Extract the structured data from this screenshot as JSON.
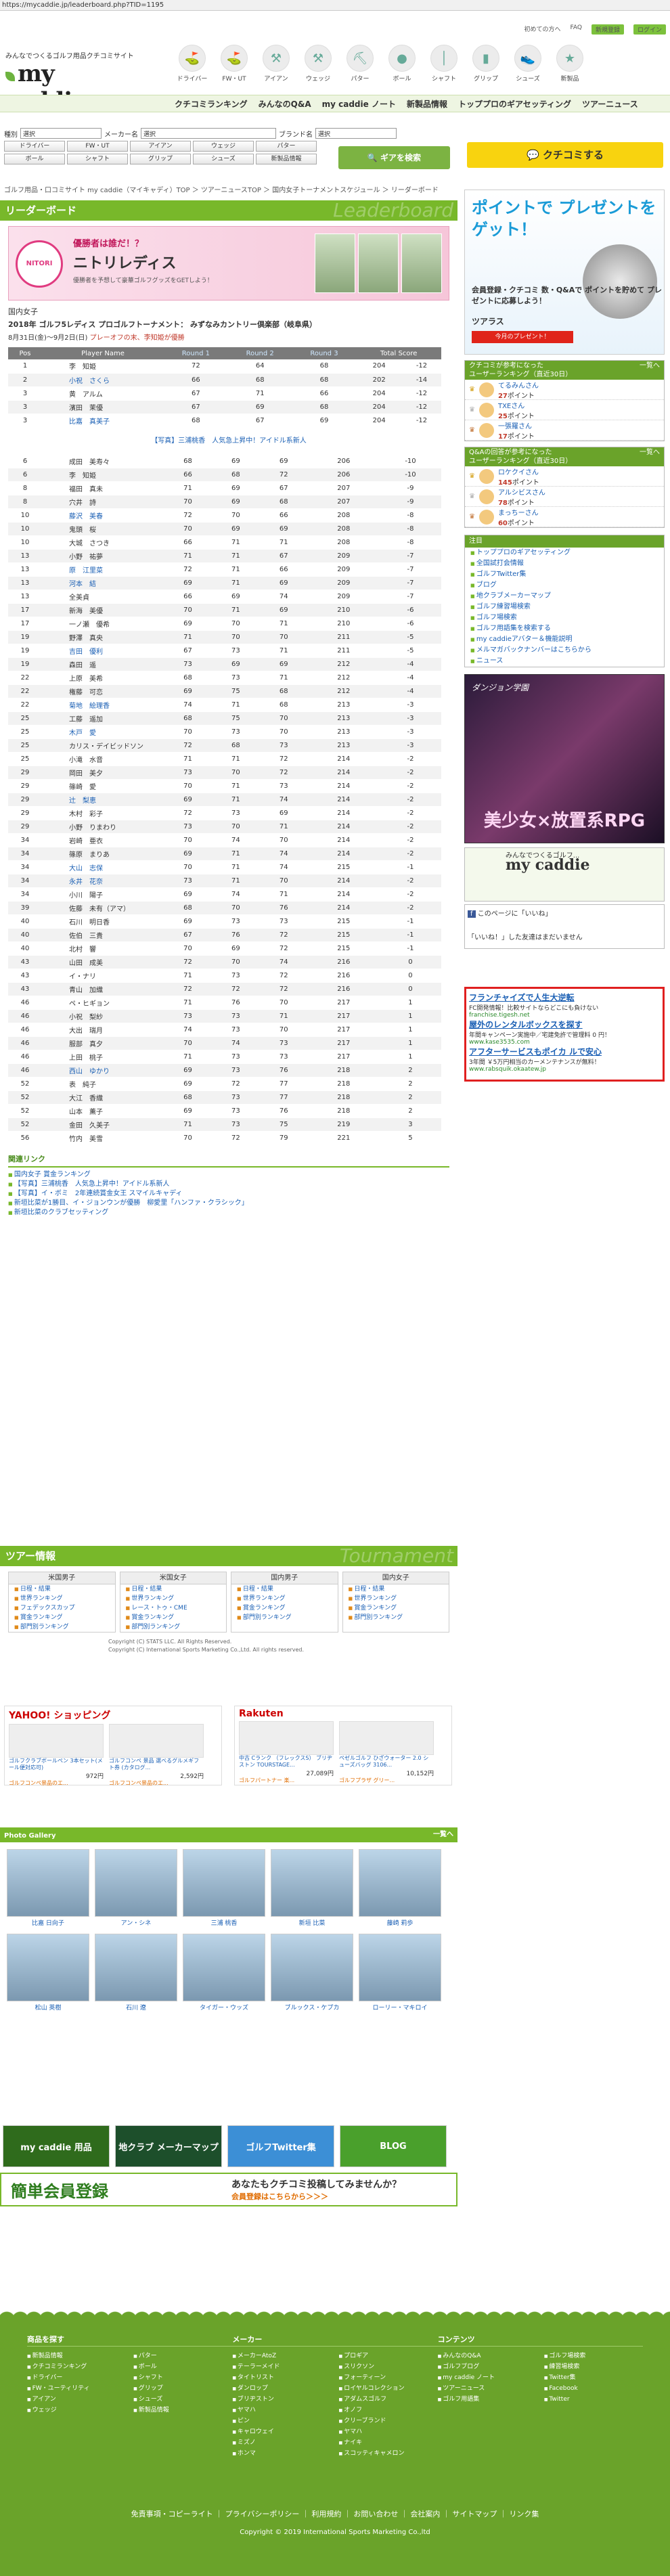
{
  "url": "https://mycaddie.jp/leaderboard.php?TID=1195",
  "header": {
    "tagline": "みんなでつくるゴルフ用品クチコミサイト",
    "logo": "my caddie",
    "toplinks": [
      "初めての方へ",
      "FAQ",
      "新規登録",
      "ログイン"
    ],
    "categories": [
      "ドライバー",
      "FW・UT",
      "アイアン",
      "ウェッジ",
      "パター",
      "ボール",
      "シャフト",
      "グリップ",
      "シューズ",
      "新製品"
    ],
    "nav": [
      "クチコミランキング",
      "みんなのQ&A",
      "my caddie ノート",
      "新製品情報",
      "トッププロのギアセッティング",
      "ツアーニュース"
    ]
  },
  "search": {
    "type_label": "種別",
    "maker_label": "メーカー名",
    "brand_label": "ブランド名",
    "type_placeholder": "選択",
    "maker_placeholder": "選択",
    "brand_placeholder": "選択",
    "genres": [
      "ドライバー",
      "FW・UT",
      "アイアン",
      "ウェッジ",
      "パター",
      "ボール",
      "シャフト",
      "グリップ",
      "シューズ",
      "新製品情報"
    ],
    "button": "ギアを検索"
  },
  "kuchikomi_button": "クチコミする",
  "breadcrumb": "ゴルフ用品・口コミサイト my caddie（マイキャディ）TOP ＞ ツアーニュースTOP ＞ 国内女子トーナメントスケジュール ＞ リーダーボード",
  "leaderboard": {
    "section_title": "リーダーボード",
    "section_bg": "Leaderboard",
    "banner": {
      "logo": "NITORI",
      "line1": "優勝者は誰だ！？",
      "line2": "ニトリレディス",
      "line3": "優勝者を予想して豪華ゴルフグッズをGETしよう！"
    },
    "tour_category": "国内女子",
    "tour_name": "2018年 ゴルフ5レディス プロゴルフトーナメント： みずなみカントリー倶楽部（岐阜県）",
    "tour_date": "8月31日(金)～9月2日(日)",
    "tour_status": "プレーオフの末、李知姫が優勝",
    "columns": [
      "Pos",
      "Player Name",
      "Round 1",
      "Round 2",
      "Round 3",
      "Total Score"
    ],
    "rows_a": [
      [
        "1",
        "李　知姫",
        "72",
        "64",
        "68",
        "204",
        "-12"
      ],
      [
        "2",
        "小祝　さくら",
        "66",
        "68",
        "68",
        "202",
        "-14"
      ],
      [
        "3",
        "黄　アルム",
        "67",
        "71",
        "66",
        "204",
        "-12"
      ],
      [
        "3",
        "濱田　茉優",
        "67",
        "69",
        "68",
        "204",
        "-12"
      ],
      [
        "3",
        "比嘉　真美子",
        "68",
        "67",
        "69",
        "204",
        "-12"
      ]
    ],
    "ad_text": "【写真】三浦桃香　人気急上昇中！アイドル系新人",
    "rows_b": [
      [
        "6",
        "成田　美寿々",
        "68",
        "69",
        "69",
        "206",
        "-10"
      ],
      [
        "6",
        "李　知姫",
        "66",
        "68",
        "72",
        "206",
        "-10"
      ],
      [
        "8",
        "福田　真未",
        "71",
        "69",
        "67",
        "207",
        "-9"
      ],
      [
        "8",
        "穴井　詩",
        "70",
        "69",
        "68",
        "207",
        "-9"
      ],
      [
        "10",
        "藤沢　美春",
        "72",
        "70",
        "66",
        "208",
        "-8"
      ],
      [
        "10",
        "鬼頭　桜",
        "70",
        "69",
        "69",
        "208",
        "-8"
      ],
      [
        "10",
        "大城　さつき",
        "66",
        "71",
        "71",
        "208",
        "-8"
      ],
      [
        "13",
        "小野　祐夢",
        "71",
        "71",
        "67",
        "209",
        "-7"
      ],
      [
        "13",
        "原　江里菜",
        "72",
        "71",
        "66",
        "209",
        "-7"
      ],
      [
        "13",
        "河本　結",
        "69",
        "71",
        "69",
        "209",
        "-7"
      ],
      [
        "13",
        "全美貞",
        "66",
        "69",
        "74",
        "209",
        "-7"
      ],
      [
        "17",
        "新海　美優",
        "70",
        "71",
        "69",
        "210",
        "-6"
      ],
      [
        "17",
        "一ノ瀬　優希",
        "69",
        "70",
        "71",
        "210",
        "-6"
      ],
      [
        "19",
        "野澤　真央",
        "71",
        "70",
        "70",
        "211",
        "-5"
      ],
      [
        "19",
        "吉田　優利",
        "67",
        "73",
        "71",
        "211",
        "-5"
      ],
      [
        "19",
        "森田　遥",
        "73",
        "69",
        "69",
        "212",
        "-4"
      ],
      [
        "22",
        "上原　美希",
        "68",
        "73",
        "71",
        "212",
        "-4"
      ],
      [
        "22",
        "権藤　可恋",
        "69",
        "75",
        "68",
        "212",
        "-4"
      ],
      [
        "22",
        "菊地　絵理香",
        "74",
        "71",
        "68",
        "213",
        "-3"
      ],
      [
        "25",
        "工藤　遥加",
        "68",
        "75",
        "70",
        "213",
        "-3"
      ],
      [
        "25",
        "木戸　愛",
        "70",
        "73",
        "70",
        "213",
        "-3"
      ],
      [
        "25",
        "カリス・デイビッドソン",
        "72",
        "68",
        "73",
        "213",
        "-3"
      ],
      [
        "25",
        "小滝　水音",
        "71",
        "71",
        "72",
        "214",
        "-2"
      ],
      [
        "29",
        "岡田　美夕",
        "73",
        "70",
        "72",
        "214",
        "-2"
      ],
      [
        "29",
        "篠崎　愛",
        "70",
        "71",
        "73",
        "214",
        "-2"
      ],
      [
        "29",
        "辻　梨恵",
        "69",
        "71",
        "74",
        "214",
        "-2"
      ],
      [
        "29",
        "木村　彩子",
        "72",
        "73",
        "69",
        "214",
        "-2"
      ],
      [
        "29",
        "小野　りまわり",
        "73",
        "70",
        "71",
        "214",
        "-2"
      ],
      [
        "34",
        "岩崎　亜衣",
        "70",
        "74",
        "70",
        "214",
        "-2"
      ],
      [
        "34",
        "篠原　まりあ",
        "69",
        "71",
        "74",
        "214",
        "-2"
      ],
      [
        "34",
        "大山　志保",
        "70",
        "71",
        "74",
        "215",
        "-1"
      ],
      [
        "34",
        "永井　花奈",
        "73",
        "71",
        "70",
        "214",
        "-2"
      ],
      [
        "34",
        "小川　陽子",
        "69",
        "74",
        "71",
        "214",
        "-2"
      ],
      [
        "39",
        "佐藤　未有（アマ）",
        "68",
        "70",
        "76",
        "214",
        "-2"
      ],
      [
        "40",
        "石川　明日香",
        "69",
        "73",
        "73",
        "215",
        "-1"
      ],
      [
        "40",
        "佐伯　三貴",
        "67",
        "76",
        "72",
        "215",
        "-1"
      ],
      [
        "40",
        "北村　響",
        "70",
        "69",
        "72",
        "215",
        "-1"
      ],
      [
        "43",
        "山田　成美",
        "72",
        "70",
        "74",
        "216",
        "0"
      ],
      [
        "43",
        "イ・ナリ",
        "71",
        "73",
        "72",
        "216",
        "0"
      ],
      [
        "43",
        "青山　加織",
        "72",
        "72",
        "72",
        "216",
        "0"
      ],
      [
        "46",
        "ペ・ヒギョン",
        "71",
        "76",
        "70",
        "217",
        "1"
      ],
      [
        "46",
        "小祝　梨紗",
        "73",
        "73",
        "71",
        "217",
        "1"
      ],
      [
        "46",
        "大出　瑞月",
        "74",
        "73",
        "70",
        "217",
        "1"
      ],
      [
        "46",
        "服部　真夕",
        "70",
        "74",
        "73",
        "217",
        "1"
      ],
      [
        "46",
        "上田　桃子",
        "71",
        "73",
        "73",
        "217",
        "1"
      ],
      [
        "46",
        "西山　ゆかり",
        "69",
        "73",
        "76",
        "218",
        "2"
      ],
      [
        "52",
        "表　純子",
        "69",
        "72",
        "77",
        "218",
        "2"
      ],
      [
        "52",
        "大江　香織",
        "68",
        "73",
        "77",
        "218",
        "2"
      ],
      [
        "52",
        "山本　薫子",
        "69",
        "73",
        "76",
        "218",
        "2"
      ],
      [
        "52",
        "金田　久美子",
        "71",
        "73",
        "75",
        "219",
        "3"
      ],
      [
        "56",
        "竹内　美雪",
        "70",
        "72",
        "79",
        "221",
        "5"
      ]
    ],
    "linked_a": [
      false,
      true,
      false,
      false,
      true
    ],
    "linked_b": [
      false,
      false,
      false,
      false,
      true,
      false,
      false,
      false,
      true,
      true,
      false,
      false,
      false,
      false,
      true,
      false,
      false,
      false,
      true,
      false,
      true,
      false,
      false,
      false,
      false,
      true,
      false,
      false,
      false,
      false,
      true,
      true,
      false,
      false,
      false,
      false,
      false,
      false,
      false,
      false,
      false,
      false,
      false,
      false,
      false,
      true,
      false,
      false,
      false,
      false,
      false
    ]
  },
  "related": {
    "title": "関連リンク",
    "items": [
      "国内女子 賞金ランキング",
      "【写真】三浦桃香　人気急上昇中！アイドル系新人",
      "【写真】イ・ボミ　2年連続賞金女王 スマイルキャディ",
      "新垣比菜が1勝目、イ・ジョンウンが優勝　柳愛里「ハンファ・クラシック」",
      "新垣比菜のクラブセッティング"
    ]
  },
  "tourinfo": {
    "title": "ツアー情報",
    "bg": "Tournament",
    "cols": [
      {
        "h": "米国男子",
        "items": [
          "日程・結果",
          "世界ランキング",
          "フェデックスカップ",
          "賞金ランキング",
          "部門別ランキング"
        ]
      },
      {
        "h": "米国女子",
        "items": [
          "日程・結果",
          "世界ランキング",
          "レース・トゥ・CME",
          "賞金ランキング",
          "部門別ランキング"
        ]
      },
      {
        "h": "国内男子",
        "items": [
          "日程・結果",
          "世界ランキング",
          "賞金ランキング",
          "部門別ランキング"
        ]
      },
      {
        "h": "国内女子",
        "items": [
          "日程・結果",
          "世界ランキング",
          "賞金ランキング",
          "部門別ランキング"
        ]
      }
    ],
    "copy1": "Copyright (C) STATS LLC. All Rights Reserved.",
    "copy2": "Copyright (C) International Sports Marketing Co.,Ltd. All rights reserved."
  },
  "shops": {
    "yahoo": {
      "logo": "YAHOO! ショッピング",
      "items": [
        {
          "t": "ゴルフクラブボールペン 3本セット(メール便対応可)",
          "p": "972円",
          "s": "ゴルフコンペ景品のエ..."
        },
        {
          "t": "ゴルフコンペ 景品 選べるグルメギフト券 (カタログ...",
          "p": "2,592円",
          "s": "ゴルフコンペ景品のエ..."
        }
      ]
    },
    "rakuten": {
      "logo": "Rakuten",
      "items": [
        {
          "t": "中古 Cランク （フレックスS） ブリヂストン TOURSTAGE...",
          "p": "27,089円",
          "s": "ゴルフパートナー 楽..."
        },
        {
          "t": "ペゼルゴルフ ひざウォーター 2.0 シューズバッグ 3106...",
          "p": "10,152円",
          "s": "ゴルフプラザ グリー..."
        }
      ]
    }
  },
  "gallery": {
    "title": "Photo Gallery",
    "more": "一覧へ",
    "row1": [
      "比嘉 日向子",
      "アン・シネ",
      "三浦 桃香",
      "新垣 比菜",
      "藤崎 莉歩"
    ],
    "row2": [
      "松山 英樹",
      "石川 遼",
      "タイガー・ウッズ",
      "ブルックス・ケプカ",
      "ローリー・マキロイ"
    ]
  },
  "promo": [
    "my caddie 用品",
    "地クラブ メーカーマップ",
    "ゴルフTwitter集",
    "BLOG"
  ],
  "register": {
    "left": "簡単会員登録",
    "right": "あなたもクチコミ投稿してみませんか？",
    "right_sub": "会員登録はこちらから＞＞＞"
  },
  "side": {
    "banner": {
      "title": "ポイントで プレゼントを ゲット！",
      "sub": "会員登録・クチコミ 数・Q&Aで ポイントを貯めて プレゼントに応募しよう！",
      "brand": "ツアラス",
      "btn": "今月のプレゼント！"
    },
    "rank1": {
      "h1": "クチコミが参考になった",
      "h2": "ユーザーランキング（直近30日）",
      "more": "一覧へ",
      "users": [
        {
          "n": "てるみんさん",
          "p": "27",
          "u": "ポイント"
        },
        {
          "n": "TXEさん",
          "p": "25",
          "u": "ポイント"
        },
        {
          "n": "一張羅さん",
          "p": "17",
          "u": "ポイント"
        }
      ]
    },
    "rank2": {
      "h1": "Q&Aの回答が参考になった",
      "h2": "ユーザーランキング（直近30日）",
      "more": "一覧へ",
      "users": [
        {
          "n": "ロケクイさん",
          "p": "145",
          "u": "ポイント"
        },
        {
          "n": "アルシビスさん",
          "p": "78",
          "u": "ポイント"
        },
        {
          "n": "まっちーさん",
          "p": "60",
          "u": "ポイント"
        }
      ]
    },
    "nav": {
      "h": "注目",
      "items": [
        "トッププロのギアセッティング",
        "全国試打会情報",
        "ゴルフTwitter集",
        "ブログ",
        "地クラブメーカーマップ",
        "ゴルフ練習場検索",
        "ゴルフ場検索",
        "ゴルフ用語集を検索する",
        "my caddieアバター＆機能説明",
        "メルマガバックナンバーはこちらから",
        "ニュース"
      ]
    },
    "game": {
      "s": "ダンジョン学園",
      "t": "美少女×放置系RPG"
    },
    "mc": {
      "t": "みんなでつくるゴルフ...",
      "n": "my caddie"
    },
    "fb": {
      "l": "このページに「いいね」",
      "s": "「いいね！」した友達はまだいません"
    },
    "ad": {
      "h1": "フランチャイズで人生大逆転",
      "t1": "FC開発情報！比較サイトならどこにも負けない",
      "u1": "franchise.tigesh.net",
      "h2": "屋外のレンタルボックスを探す",
      "t2": "年間キャンペーン実施中／宅建免許で管理料 0 円！",
      "u2": "www.kase3535.com",
      "h3": "アフターサービスもポイカ ルで安心",
      "t3": "3年間 ￥5万円相当のカーメンテナンスが無料！",
      "u3": "www.rabsquik.okaatew.jp"
    }
  },
  "footer": {
    "cols": [
      {
        "h": "商品を探す",
        "items": [
          "新製品情報",
          "クチコミランキング",
          "ドライバー",
          "FW・ユーティリティ",
          "アイアン",
          "ウェッジ",
          "パター",
          "ボール",
          "シャフト",
          "グリップ",
          "シューズ",
          "新製品情報"
        ]
      },
      {
        "h": "メーカー",
        "items": [
          "メーカーAtoZ",
          "テーラーメイド",
          "タイトリスト",
          "ダンロップ",
          "ブリヂストン",
          "ヤマハ",
          "ピン",
          "キャロウェイ",
          "ミズノ",
          "ホンマ",
          "プロギア",
          "スリクソン",
          "フォーティーン",
          "ロイヤルコレクション",
          "アダムスゴルフ",
          "オノフ",
          "クリーブランド",
          "ヤマハ",
          "ナイキ",
          "スコッティキャメロン"
        ]
      },
      {
        "h": "コンテンツ",
        "items": [
          "みんなのQ&A",
          "ゴルフブログ",
          "my caddie ノート",
          "ツアーニュース",
          "ゴルフ用語集",
          "ゴルフ場検索",
          "練習場検索",
          "Twitter集",
          "Facebook",
          "Twitter"
        ]
      }
    ],
    "links": "免責事項・コピーライト ｜ プライバシーポリシー ｜ 利用規約 ｜ お問い合わせ ｜ 会社案内 ｜ サイトマップ ｜ リンク集",
    "copy": "Copyright © 2019 International Sports Marketing Co.,ltd"
  }
}
